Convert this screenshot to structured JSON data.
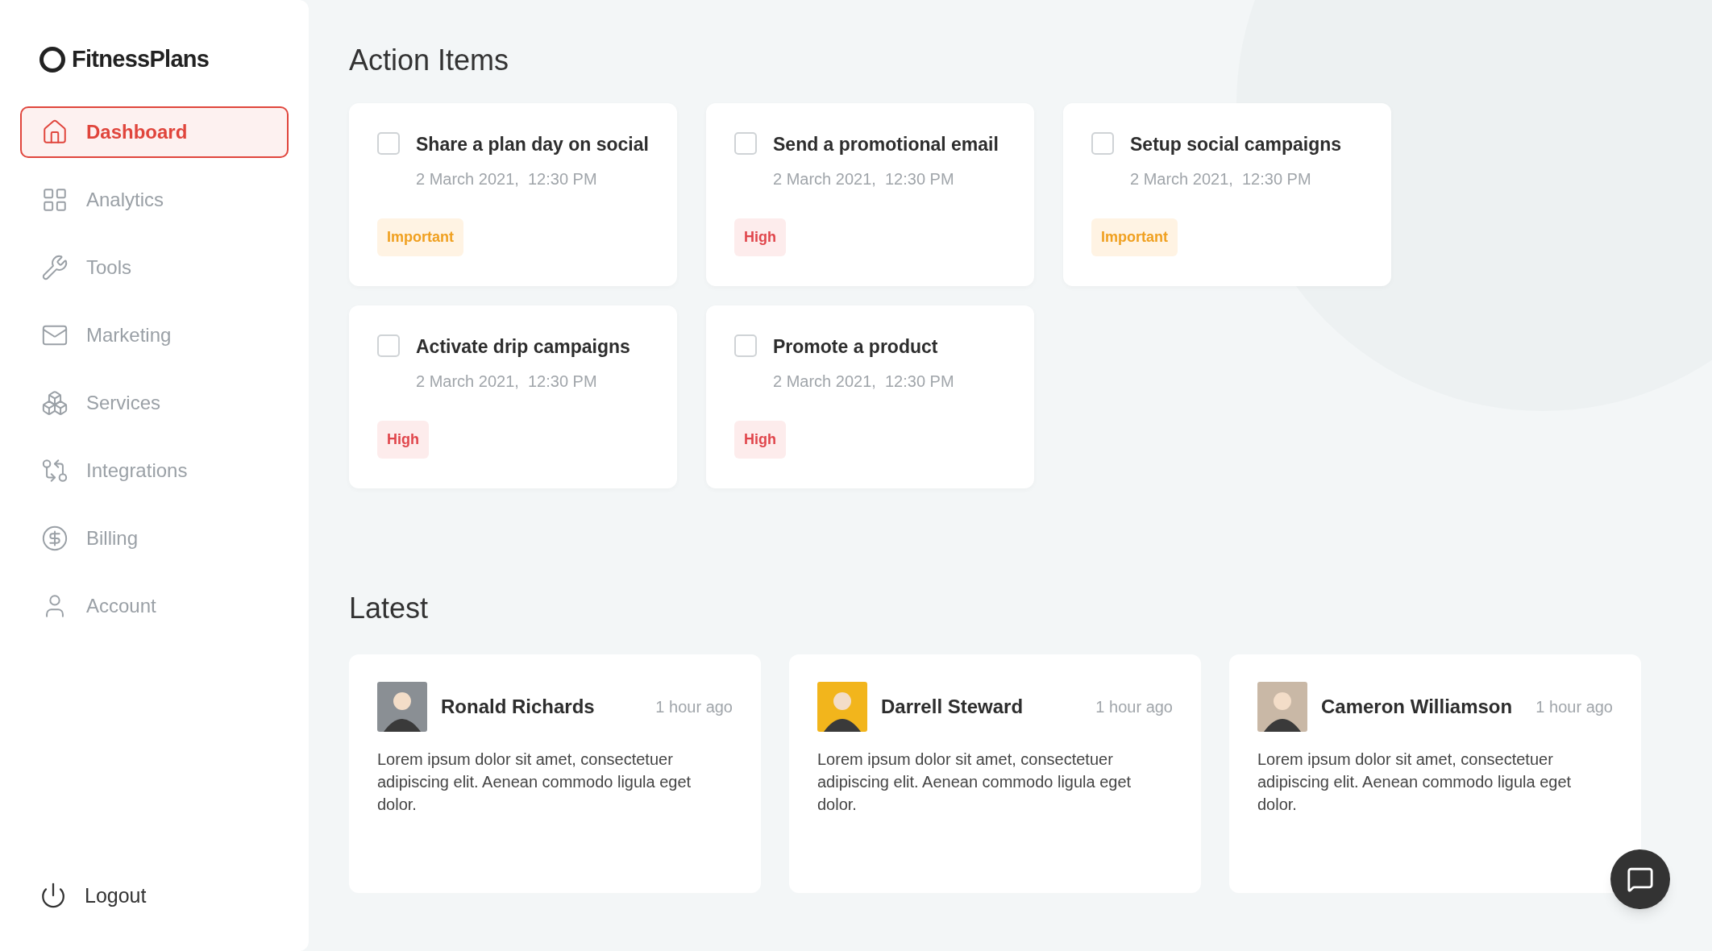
{
  "sidebar": {
    "logo": "FitnessPlans",
    "items": [
      {
        "label": "Dashboard",
        "kind": "home",
        "selected": true
      },
      {
        "label": "Analytics",
        "kind": "grid",
        "selected": false
      },
      {
        "label": "Tools",
        "kind": "tools",
        "selected": false
      },
      {
        "label": "Marketing",
        "kind": "mail",
        "selected": false
      },
      {
        "label": "Services",
        "kind": "squares",
        "selected": false
      },
      {
        "label": "Integrations",
        "kind": "git",
        "selected": false
      },
      {
        "label": "Billing",
        "kind": "dollar",
        "selected": false
      },
      {
        "label": "Account",
        "kind": "user",
        "selected": false
      }
    ],
    "logout": "Logout"
  },
  "action_items": {
    "title": "Action Items",
    "cards": [
      {
        "title": "Share a plan day on social",
        "date": "2 March 2021,  12:30 PM",
        "checked": false,
        "tag": "Important",
        "kind": "important"
      },
      {
        "title": "Send a promotional email",
        "date": "2 March 2021,  12:30 PM",
        "checked": false,
        "tag": "High",
        "kind": "high"
      },
      {
        "title": "Setup social campaigns",
        "date": "2 March 2021,  12:30 PM",
        "checked": false,
        "tag": "Important",
        "kind": "important"
      },
      {
        "title": "Activate drip campaigns",
        "date": "2 March 2021,  12:30 PM",
        "checked": false,
        "tag": "High",
        "kind": "high"
      },
      {
        "title": "Promote a product",
        "date": "2 March 2021,  12:30 PM",
        "checked": false,
        "tag": "High",
        "kind": "high"
      }
    ]
  },
  "latest": {
    "title": "Latest",
    "posts": [
      {
        "name": "Ronald Richards",
        "time": "1 hour ago",
        "text": "Lorem ipsum dolor sit amet, consectetuer adipiscing elit. Aenean commodo ligula eget dolor.",
        "color": "#8a8f94"
      },
      {
        "name": "Darrell Steward",
        "time": "1 hour ago",
        "text": "Lorem ipsum dolor sit amet, consectetuer adipiscing elit. Aenean commodo ligula eget dolor.",
        "color": "#f2b51c"
      },
      {
        "name": "Cameron Williamson",
        "time": "1 hour ago",
        "text": "Lorem ipsum dolor sit amet, consectetuer adipiscing elit. Aenean commodo ligula eget dolor.",
        "color": "#c9b8a6"
      }
    ]
  }
}
